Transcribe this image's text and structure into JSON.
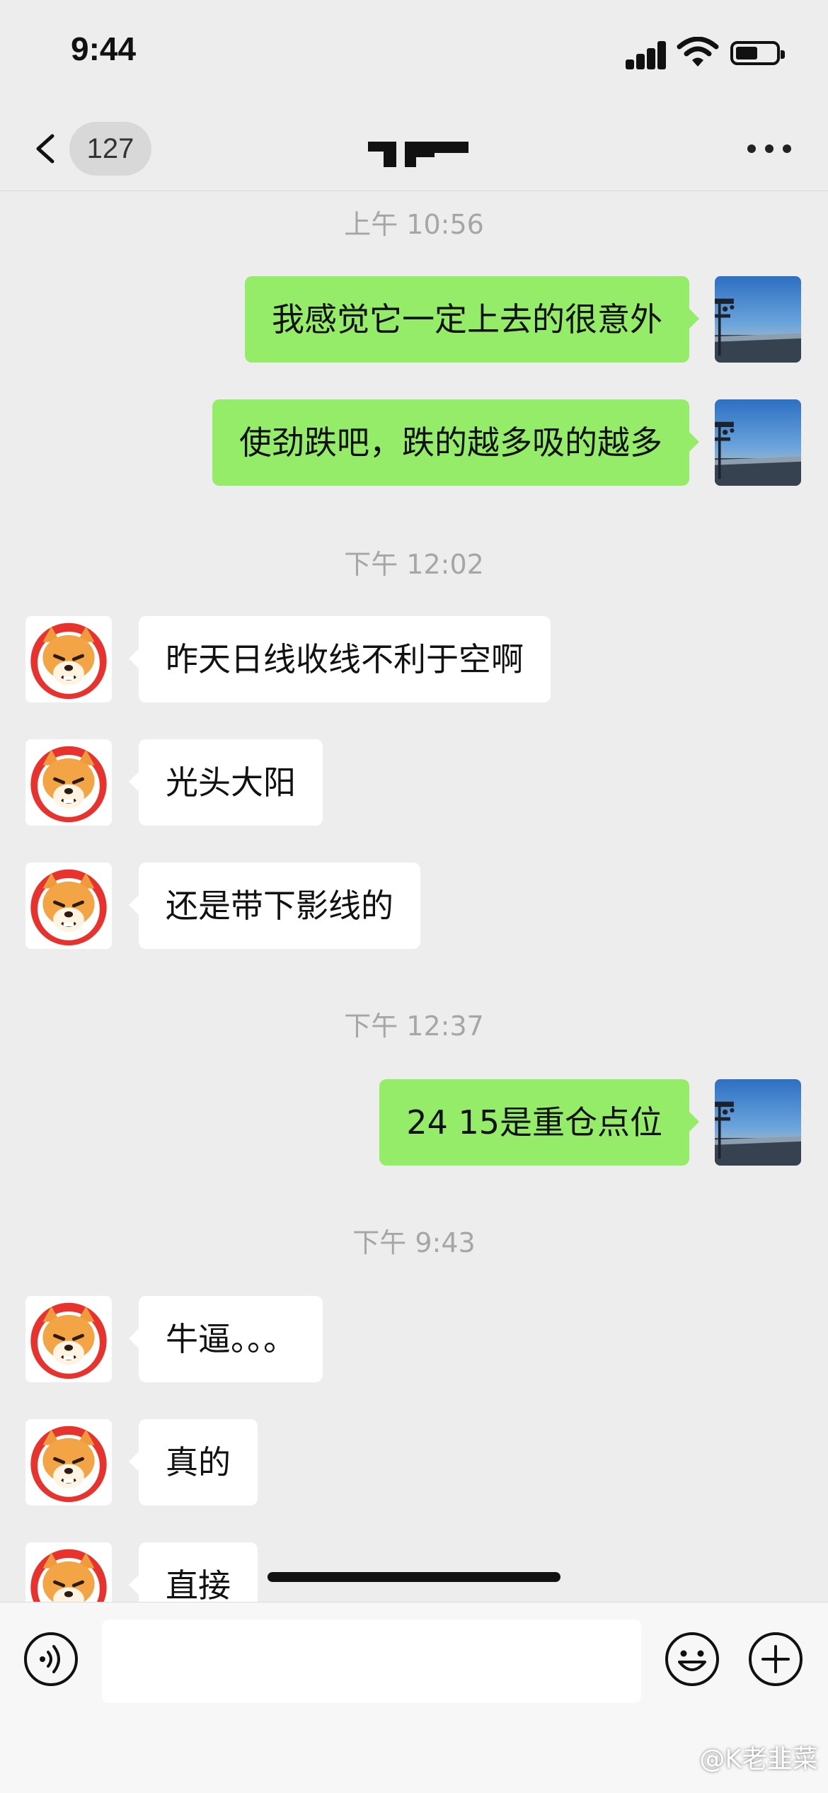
{
  "status_bar": {
    "time": "9:44"
  },
  "nav": {
    "unread_count": "127",
    "chat_title": ""
  },
  "timestamps": [
    "上午 10:56",
    "下午 12:02",
    "下午 12:37",
    "下午 9:43"
  ],
  "messages": [
    {
      "side": "right",
      "text": "我感觉它一定上去的很意外"
    },
    {
      "side": "right",
      "text": "使劲跌吧，跌的越多吸的越多"
    },
    {
      "side": "left",
      "text": "昨天日线收线不利于空啊"
    },
    {
      "side": "left",
      "text": "光头大阳"
    },
    {
      "side": "left",
      "text": "还是带下影线的"
    },
    {
      "side": "right",
      "text": "24 15是重仓点位"
    },
    {
      "side": "left",
      "text": "牛逼。。。"
    },
    {
      "side": "left",
      "text": "真的"
    },
    {
      "side": "left",
      "text": "直接"
    }
  ],
  "input": {
    "placeholder": "",
    "value": ""
  },
  "watermark": "@K老韭菜",
  "colors": {
    "background": "#ededed",
    "outgoing_bubble": "#95ec69",
    "incoming_bubble": "#ffffff",
    "timestamp": "#a6a6a6"
  },
  "icons": {
    "back": "chevron-left-icon",
    "more": "more-dots-icon",
    "voice": "voice-icon",
    "emoji": "emoji-icon",
    "plus": "plus-icon",
    "signal": "signal-icon",
    "wifi": "wifi-icon",
    "battery": "battery-icon",
    "contact_avatar": "shiba-avatar-icon",
    "my_avatar": "city-view-avatar"
  }
}
